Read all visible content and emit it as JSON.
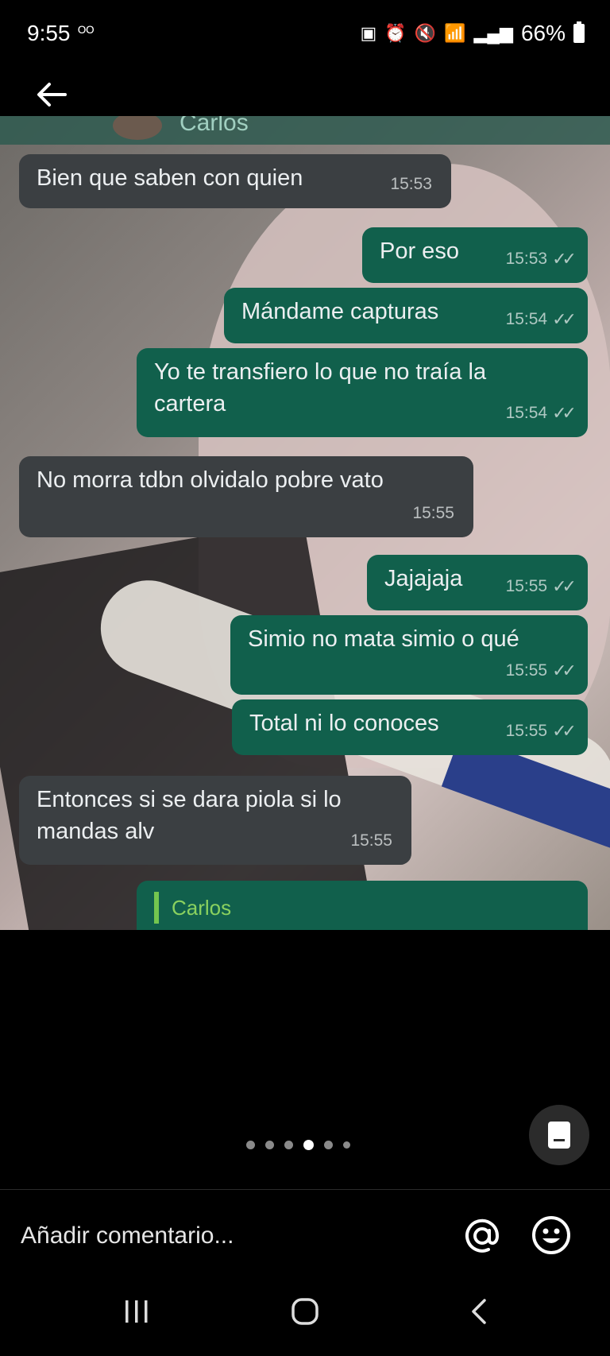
{
  "status": {
    "time": "9:55",
    "battery": "66%"
  },
  "conversation": {
    "contact": "Carlos",
    "messages": [
      {
        "dir": "in",
        "text": "Bien que saben con quien",
        "time": "15:53"
      },
      {
        "dir": "out",
        "text": "Por eso",
        "time": "15:53"
      },
      {
        "dir": "out",
        "text": "Mándame capturas",
        "time": "15:54"
      },
      {
        "dir": "out",
        "text": "Yo te transfiero lo que no traía la cartera",
        "time": "15:54"
      },
      {
        "dir": "in",
        "text": "No morra tdbn olvidalo pobre vato",
        "time": "15:55"
      },
      {
        "dir": "out",
        "text": "Jajajaja",
        "time": "15:55"
      },
      {
        "dir": "out",
        "text": "Simio no mata simio o qué",
        "time": "15:55"
      },
      {
        "dir": "out",
        "text": "Total ni lo conoces",
        "time": "15:55"
      },
      {
        "dir": "in",
        "text": "Entonces si se dara piola si lo mandas alv",
        "time": "15:55"
      }
    ],
    "quoted_name": "Carlos"
  },
  "pager": {
    "total": 6,
    "active": 4
  },
  "comment": {
    "placeholder": "Añadir comentario..."
  },
  "icons": {
    "back": "arrow-left-icon",
    "document": "document-icon",
    "mention": "at-icon",
    "emoji": "smiley-icon",
    "nav": [
      "recents-icon",
      "home-icon",
      "back-icon"
    ]
  },
  "colors": {
    "incoming": "#3b3f42",
    "outgoing": "#11604c",
    "quote_accent": "#74c64f"
  }
}
